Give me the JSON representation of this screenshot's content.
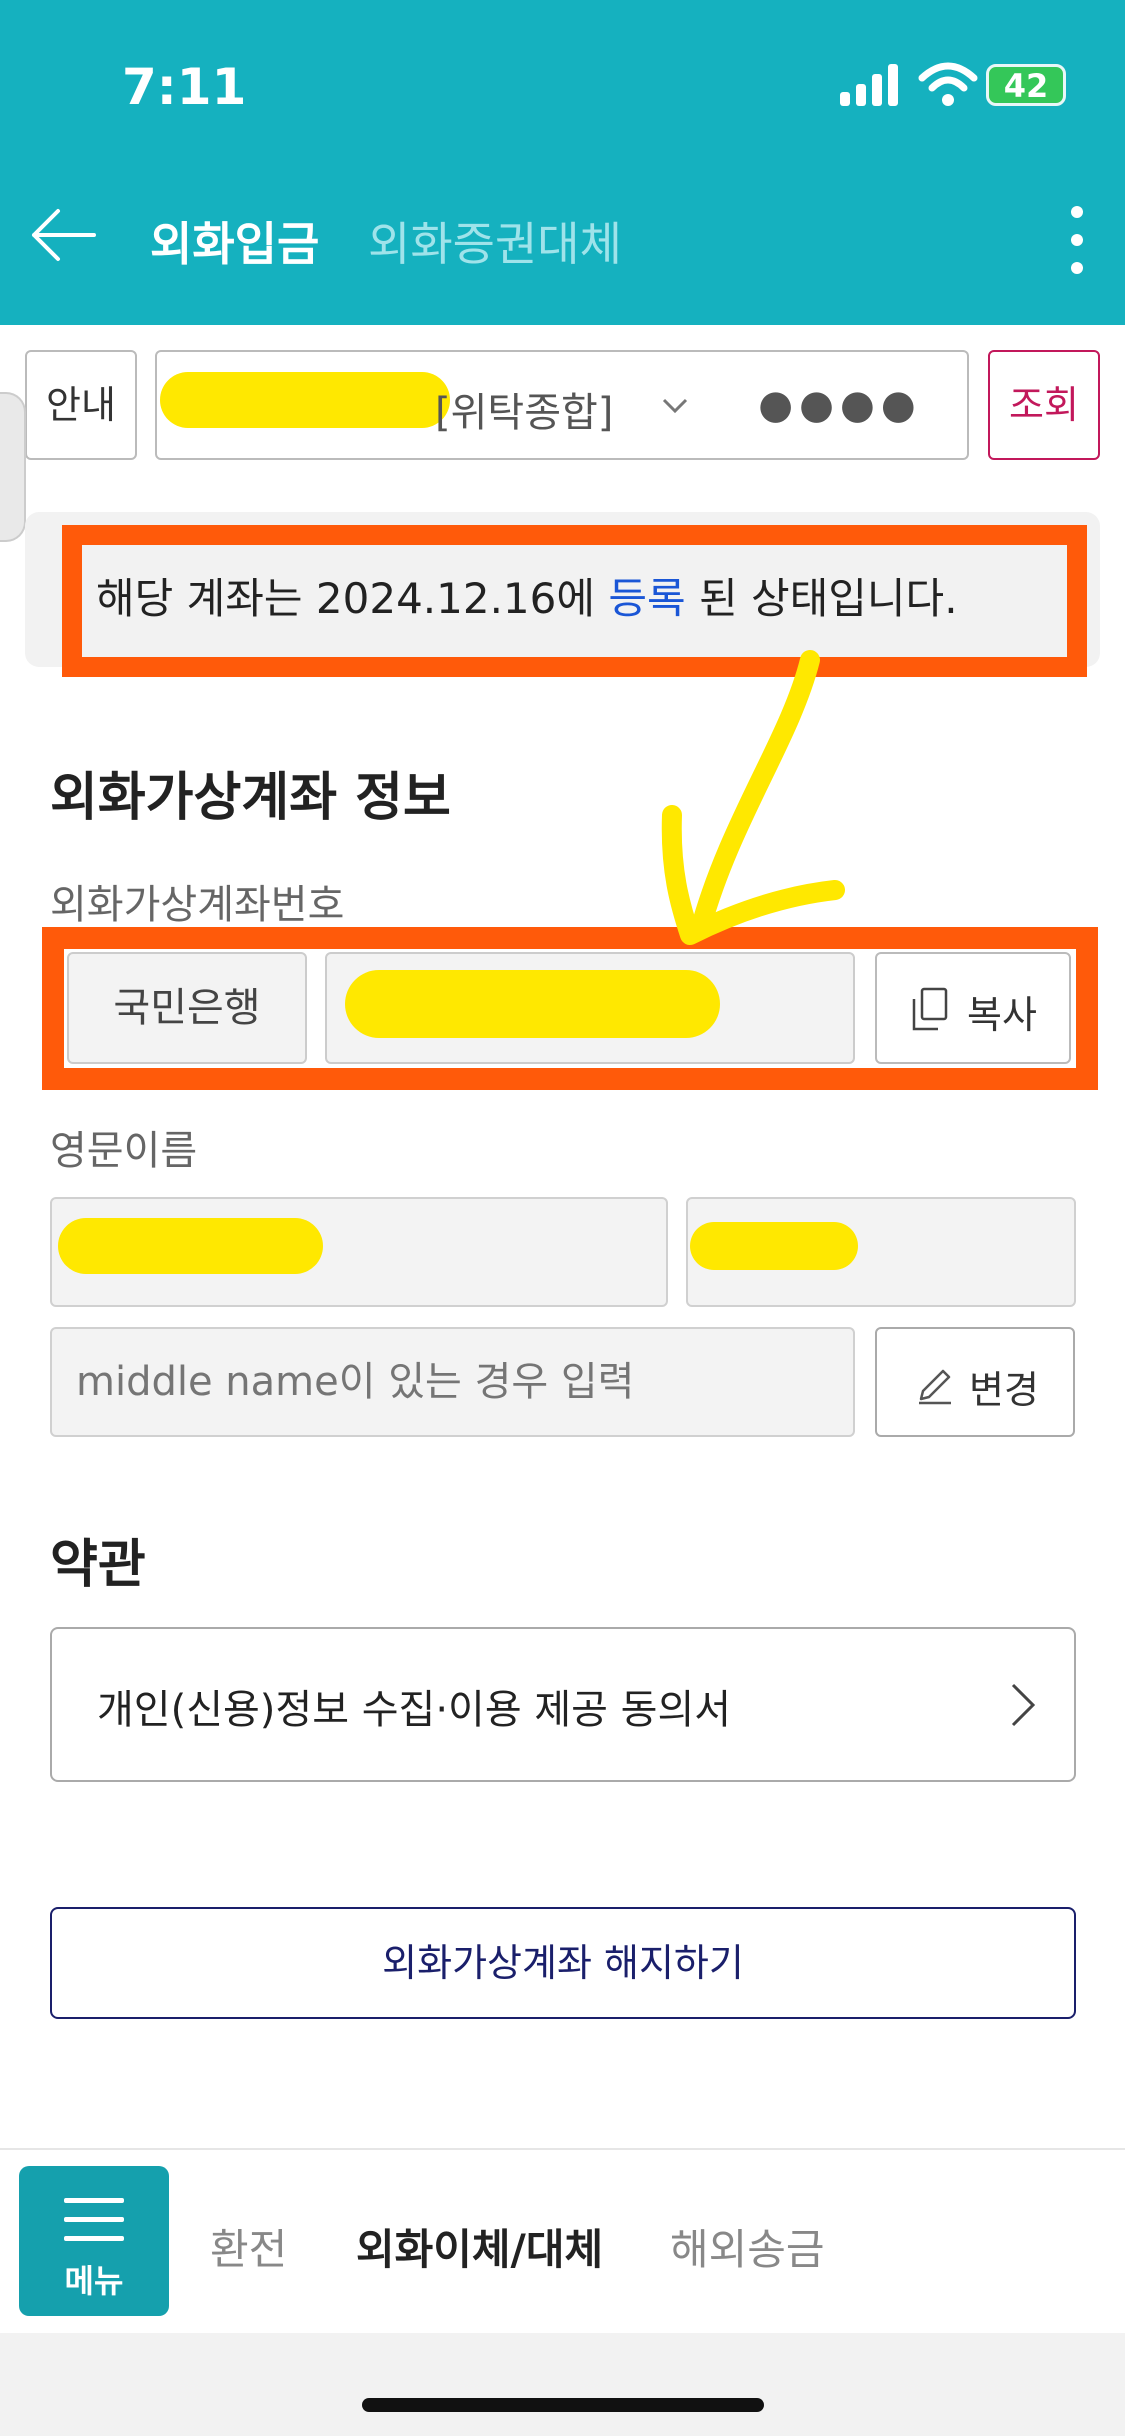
{
  "status_bar": {
    "time": "7:11",
    "battery": "42"
  },
  "header": {
    "tabs": [
      {
        "label": "외화입금",
        "active": true
      },
      {
        "label": "외화증권대체",
        "active": false
      }
    ],
    "icons": [
      "back-arrow-icon",
      "more-vertical-icon"
    ]
  },
  "account_bar": {
    "guide_label": "안내",
    "account_suffix": "[위탁종합]",
    "password_mask": "●●●●",
    "query_label": "조회"
  },
  "notice": {
    "prefix": "해당 계좌는 2024.12.16에 ",
    "highlight": "등록",
    "suffix": " 된 상태입니다."
  },
  "virtual_account": {
    "section_title": "외화가상계좌 정보",
    "number_label": "외화가상계좌번호",
    "bank": "국민은행",
    "copy_label": "복사",
    "english_name_label": "영문이름",
    "middle_name_placeholder": "middle name이 있는 경우 입력",
    "edit_label": "변경"
  },
  "terms": {
    "title": "약관",
    "item": "개인(신용)정보 수집·이용 제공 동의서"
  },
  "cancel_button": "외화가상계좌 해지하기",
  "bottom_nav": {
    "menu_label": "메뉴",
    "items": [
      "환전",
      "외화이체/대체",
      "해외송금"
    ]
  },
  "colors": {
    "header_bg": "#15b1bf",
    "annotation_orange": "#ff5a0a",
    "redaction_yellow": "#ffe800",
    "query_accent": "#c2185b",
    "link_blue": "#1a56d6"
  }
}
